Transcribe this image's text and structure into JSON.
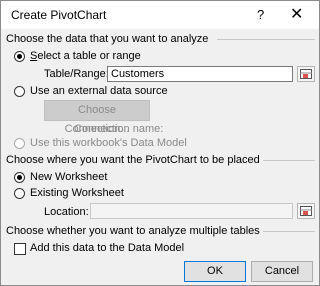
{
  "window": {
    "title": "Create PivotChart",
    "help_glyph": "?",
    "close_glyph": "✕"
  },
  "section1": {
    "title": "Choose the data that you want to analyze",
    "select_table": "Select a table or range",
    "table_range_label": "Table/Range:",
    "table_range_value": "Customers",
    "external_source": "Use an external data source",
    "choose_connection": "Choose Connection...",
    "connection_name_label": "Connection name:",
    "data_model": "Use this workbook's Data Model"
  },
  "section2": {
    "title": "Choose where you want the PivotChart to be placed",
    "new_worksheet": "New Worksheet",
    "existing_worksheet": "Existing Worksheet",
    "location_label": "Location:",
    "location_value": ""
  },
  "section3": {
    "title": "Choose whether you want to analyze multiple tables",
    "add_data_model": "Add this data to the Data Model"
  },
  "buttons": {
    "ok": "OK",
    "cancel": "Cancel"
  },
  "icons": {
    "range_selector": "range-select-icon"
  },
  "colors": {
    "accent": "#0078d7"
  }
}
